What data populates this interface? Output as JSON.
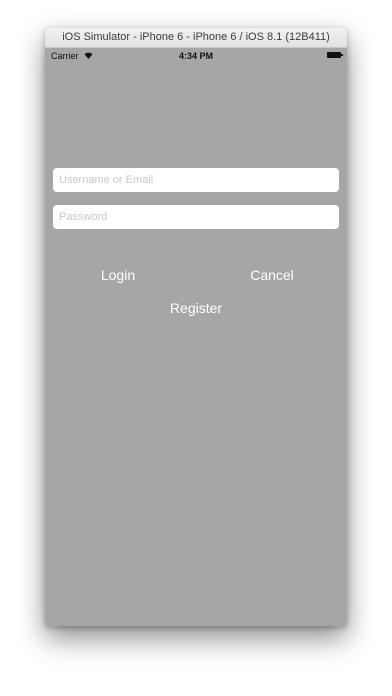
{
  "window": {
    "title": "iOS Simulator - iPhone 6 - iPhone 6 / iOS 8.1 (12B411)"
  },
  "status_bar": {
    "carrier": "Carrier",
    "time": "4:34 PM",
    "icons": [
      "wifi-icon",
      "battery-icon"
    ]
  },
  "login_form": {
    "username_placeholder": "Username or Email",
    "username_value": "",
    "password_placeholder": "Password",
    "password_value": "",
    "login_label": "Login",
    "cancel_label": "Cancel",
    "register_label": "Register"
  },
  "colors": {
    "screen_background": "#a6a6a6",
    "button_text": "#ffffff",
    "field_background": "#ffffff",
    "placeholder_text": "#c7c7cd"
  }
}
